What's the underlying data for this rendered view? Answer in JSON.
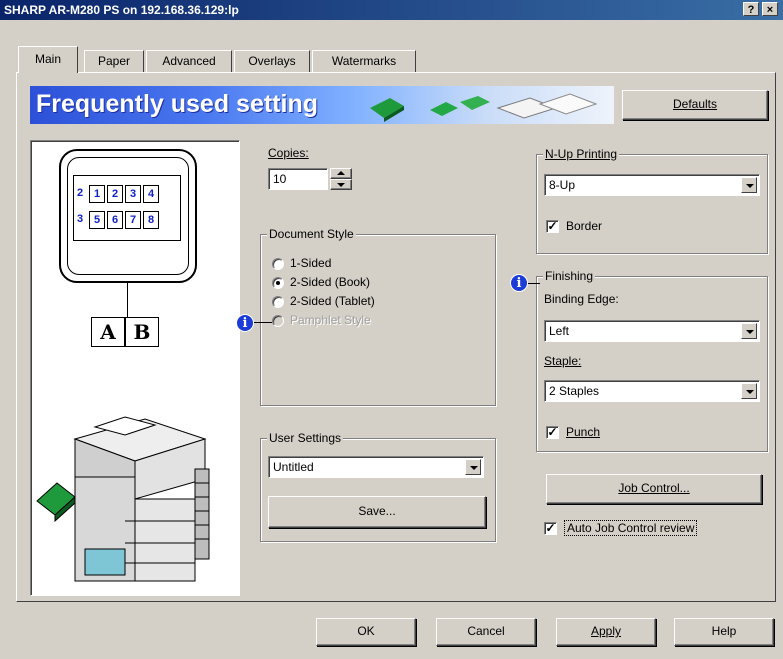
{
  "window": {
    "title": "SHARP AR-M280 PS on 192.168.36.129:lp",
    "help_button": "?",
    "close_button": "×"
  },
  "tabs": [
    "Main",
    "Paper",
    "Advanced",
    "Overlays",
    "Watermarks"
  ],
  "banner": {
    "text": "Frequently used setting"
  },
  "defaults_button": "Defaults",
  "copies": {
    "label": "Copies:",
    "value": "10"
  },
  "document_style": {
    "legend": "Document Style",
    "options": [
      {
        "label": "1-Sided",
        "selected": false,
        "enabled": true
      },
      {
        "label": "2-Sided (Book)",
        "selected": true,
        "enabled": true
      },
      {
        "label": "2-Sided (Tablet)",
        "selected": false,
        "enabled": true
      },
      {
        "label": "Pamphlet Style",
        "selected": false,
        "enabled": false
      }
    ]
  },
  "user_settings": {
    "legend": "User Settings",
    "selected": "Untitled",
    "save_button": "Save..."
  },
  "nup": {
    "legend": "N-Up Printing",
    "selected": "8-Up",
    "border_label": "Border",
    "border_checked": true
  },
  "finishing": {
    "legend": "Finishing",
    "binding_label": "Binding Edge:",
    "binding_value": "Left",
    "staple_label": "Staple:",
    "staple_value": "2 Staples",
    "punch_label": "Punch",
    "punch_checked": true
  },
  "job_control_button": "Job Control...",
  "auto_job_review": {
    "label": "Auto Job Control review",
    "checked": true
  },
  "footer": {
    "ok": "OK",
    "cancel": "Cancel",
    "apply": "Apply",
    "help": "Help"
  },
  "preview": {
    "pages_row1": [
      "1",
      "2",
      "3",
      "4"
    ],
    "pages_row2": [
      "5",
      "6",
      "7",
      "8"
    ],
    "left_marks": [
      "2",
      "3"
    ],
    "letters": [
      "A",
      "B"
    ]
  },
  "icons": [
    "info-icon",
    "spin-up-icon",
    "spin-down-icon",
    "dropdown-arrow-icon",
    "printer-icon",
    "green-paper-icon"
  ],
  "colors": {
    "titlebar": "#0a246a",
    "banner": "#2c50d8",
    "page_numbers": "#1020c8",
    "info": "#1c3cd8"
  }
}
